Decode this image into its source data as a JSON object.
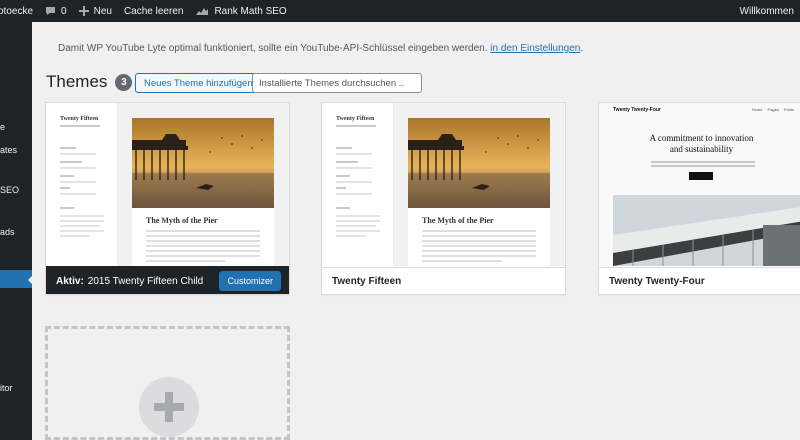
{
  "admin_bar": {
    "site_name": "otoecke",
    "comments_count": "0",
    "new_label": "Neu",
    "cache_label": "Cache leeren",
    "rankmath_label": "Rank Math SEO",
    "greeting": "Willkommen"
  },
  "sidebar": {
    "items": [
      "e",
      "ates",
      "SEO",
      "ads",
      "itor"
    ]
  },
  "notice": {
    "text": "Damit WP YouTube Lyte optimal funktioniert, sollte ein YouTube-API-Schlüssel eingeben werden.",
    "link": "in den Einstellungen",
    "end": "."
  },
  "page": {
    "title": "Themes",
    "count": "3",
    "add_button": "Neues Theme hinzufügen",
    "search_placeholder": "Installierte Themes durchsuchen ..."
  },
  "themes": [
    {
      "active_prefix": "Aktiv:",
      "name": "2015 Twenty Fifteen Child",
      "action": "Customizer",
      "preview_site_title": "Twenty Fifteen",
      "preview_post_title": "The Myth of the Pier"
    },
    {
      "name": "Twenty Fifteen",
      "preview_site_title": "Twenty Fifteen",
      "preview_post_title": "The Myth of the Pier"
    },
    {
      "name": "Twenty Twenty-Four",
      "preview_site_title": "Twenty Twenty-Four",
      "preview_nav": "Home Pages Posts",
      "preview_heading_1": "A commitment to innovation",
      "preview_heading_2": "and sustainability"
    }
  ],
  "colors": {
    "accent": "#2271b1",
    "admin_dark": "#1d2327",
    "background": "#f0f0f1"
  }
}
